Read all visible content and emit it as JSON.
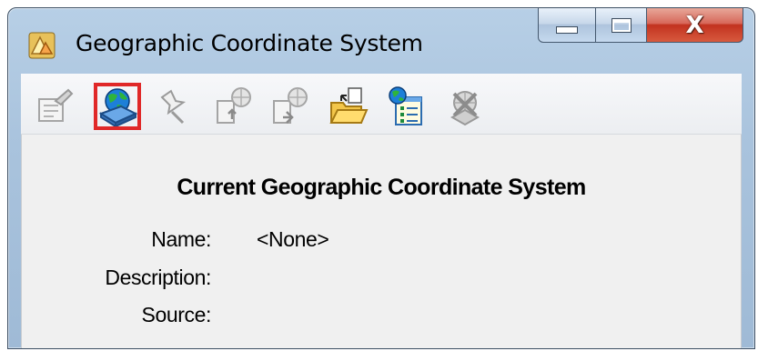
{
  "window": {
    "title": "Geographic Coordinate System",
    "close_label": "X"
  },
  "toolbar": {
    "buttons": [
      {
        "icon": "properties-icon",
        "enabled": false
      },
      {
        "icon": "globe-disk-icon",
        "enabled": true,
        "highlighted": true
      },
      {
        "icon": "pushpin-icon",
        "enabled": false
      },
      {
        "icon": "import-globe-icon",
        "enabled": false
      },
      {
        "icon": "export-globe-icon",
        "enabled": false
      },
      {
        "icon": "open-folder-icon",
        "enabled": true
      },
      {
        "icon": "globe-list-icon",
        "enabled": true
      },
      {
        "icon": "delete-globe-icon",
        "enabled": false
      }
    ]
  },
  "main": {
    "heading": "Current Geographic Coordinate System",
    "fields": {
      "name_label": "Name:",
      "name_value": "<None>",
      "description_label": "Description:",
      "description_value": "",
      "source_label": "Source:",
      "source_value": ""
    }
  },
  "colors": {
    "highlight": "#e02828",
    "close_button": "#c2321f",
    "frame": "#a9c3dd"
  }
}
